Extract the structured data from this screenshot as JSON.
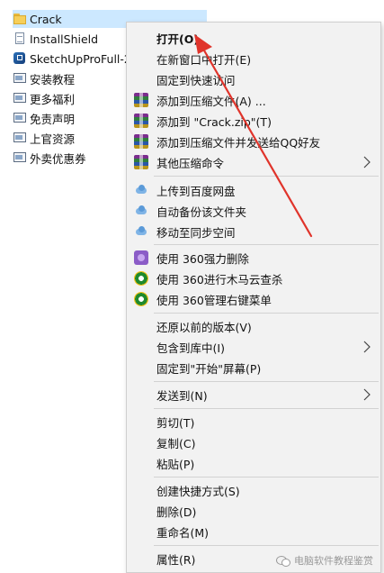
{
  "files": [
    {
      "name": "Crack",
      "icon": "folder-icon",
      "selected": true
    },
    {
      "name": "InstallShield",
      "icon": "document-icon"
    },
    {
      "name": "SketchUpProFull-2",
      "icon": "app-icon"
    },
    {
      "name": "安装教程",
      "icon": "web-shortcut-icon"
    },
    {
      "name": "更多福利",
      "icon": "web-shortcut-icon"
    },
    {
      "name": "免责声明",
      "icon": "web-shortcut-icon"
    },
    {
      "name": "上官资源",
      "icon": "web-shortcut-icon"
    },
    {
      "name": "外卖优惠券",
      "icon": "web-shortcut-icon"
    }
  ],
  "menu": {
    "open": "打开(O)",
    "open_new_window": "在新窗口中打开(E)",
    "pin_quick_access": "固定到快速访问",
    "add_to_archive": "添加到压缩文件(A) ...",
    "add_to_crack_zip": "添加到 \"Crack.zip\"(T)",
    "add_and_mail_qq": "添加到压缩文件并发送给QQ好友",
    "other_compress": "其他压缩命令",
    "upload_baidu": "上传到百度网盘",
    "auto_backup": "自动备份该文件夹",
    "move_sync": "移动至同步空间",
    "shred_360": "使用 360强力删除",
    "scan_360": "使用 360进行木马云查杀",
    "manage_360": "使用 360管理右键菜单",
    "restore_previous": "还原以前的版本(V)",
    "include_library": "包含到库中(I)",
    "pin_start": "固定到\"开始\"屏幕(P)",
    "send_to": "发送到(N)",
    "cut": "剪切(T)",
    "copy": "复制(C)",
    "paste": "粘贴(P)",
    "create_shortcut": "创建快捷方式(S)",
    "delete": "删除(D)",
    "rename": "重命名(M)",
    "properties": "属性(R)"
  },
  "watermark": "电脑软件教程鉴赏",
  "colors": {
    "selection": "#cce8ff",
    "menu_bg": "#f2f2f2",
    "arrow": "#e0342b"
  }
}
